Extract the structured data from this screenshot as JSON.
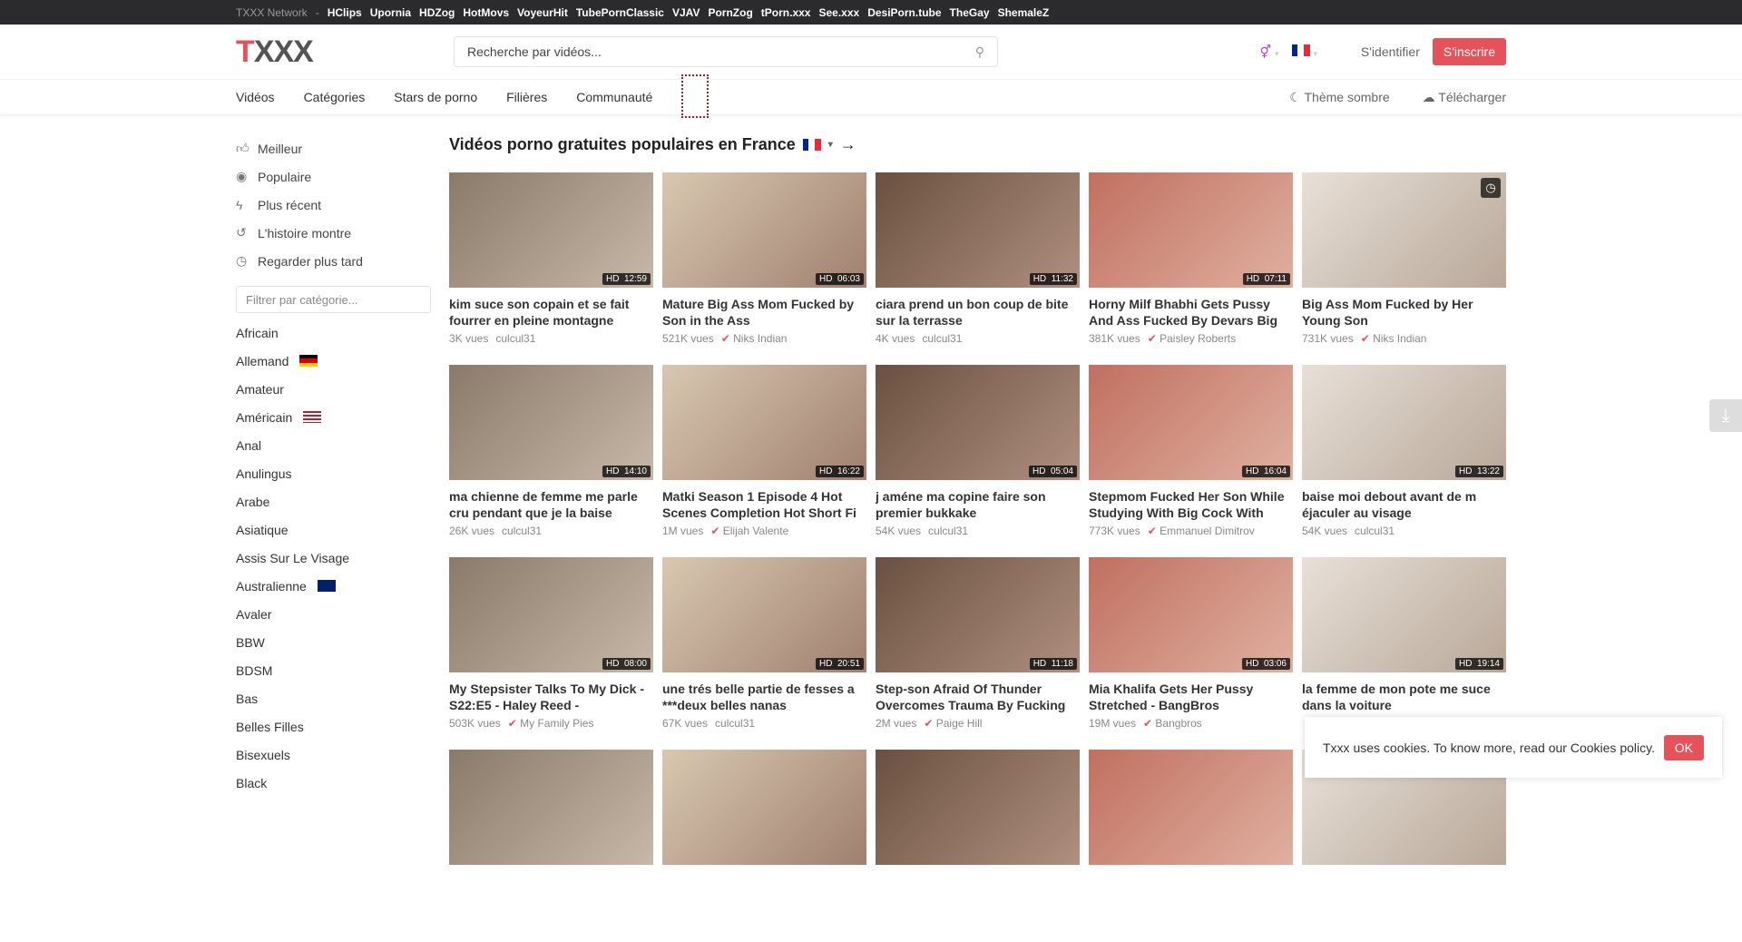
{
  "network": {
    "label": "TXXX Network",
    "sep": "-",
    "sites": [
      "HClips",
      "Upornia",
      "HDZog",
      "HotMovs",
      "VoyeurHit",
      "TubePornClassic",
      "VJAV",
      "PornZog",
      "tPorn.xxx",
      "See.xxx",
      "DesiPorn.tube",
      "TheGay",
      "ShemaleZ"
    ]
  },
  "header": {
    "logo_t": "T",
    "logo_x": "XXX",
    "search_placeholder": "Recherche par vidéos...",
    "login": "S'identifier",
    "signup": "S'inscrire"
  },
  "nav": {
    "items": [
      "Vidéos",
      "Catégories",
      "Stars de porno",
      "Filières",
      "Communauté"
    ],
    "dark_theme": "Thème sombre",
    "upload": "Télécharger"
  },
  "sidebar": {
    "items": [
      {
        "icon": "thumbs-up-icon",
        "label": "Meilleur"
      },
      {
        "icon": "eye-icon",
        "label": "Populaire"
      },
      {
        "icon": "bolt-icon",
        "label": "Plus récent"
      },
      {
        "icon": "history-icon",
        "label": "L'histoire montre"
      },
      {
        "icon": "clock-icon",
        "label": "Regarder plus tard"
      }
    ],
    "filter_placeholder": "Filtrer par catégorie...",
    "categories": [
      {
        "label": "Africain"
      },
      {
        "label": "Allemand",
        "flag": "de"
      },
      {
        "label": "Amateur"
      },
      {
        "label": "Américain",
        "flag": "us"
      },
      {
        "label": "Anal"
      },
      {
        "label": "Anulingus"
      },
      {
        "label": "Arabe"
      },
      {
        "label": "Asiatique"
      },
      {
        "label": "Assis Sur Le Visage"
      },
      {
        "label": "Australienne",
        "flag": "au"
      },
      {
        "label": "Avaler"
      },
      {
        "label": "BBW"
      },
      {
        "label": "BDSM"
      },
      {
        "label": "Bas"
      },
      {
        "label": "Belles Filles"
      },
      {
        "label": "Bisexuels"
      },
      {
        "label": "Black"
      }
    ]
  },
  "main": {
    "title": "Vidéos porno gratuites populaires en France",
    "videos": [
      {
        "title": "kim suce son copain et se fait fourrer en pleine montagne",
        "views": "3K vues",
        "author": "culcul31",
        "verified": false,
        "duration": "12:59"
      },
      {
        "title": "Mature Big Ass Mom Fucked by Son in the Ass",
        "views": "521K vues",
        "author": "Niks Indian",
        "verified": true,
        "duration": "06:03"
      },
      {
        "title": "ciara prend un bon coup de bite sur la terrasse",
        "views": "4K vues",
        "author": "culcul31",
        "verified": false,
        "duration": "11:32"
      },
      {
        "title": "Horny Milf Bhabhi Gets Pussy And Ass Fucked By Devars Big Cock",
        "views": "381K vues",
        "author": "Paisley Roberts",
        "verified": true,
        "duration": "07:11"
      },
      {
        "title": "Big Ass Mom Fucked by Her Young Son",
        "views": "731K vues",
        "author": "Niks Indian",
        "verified": true,
        "watch_later": true
      },
      {
        "title": "ma chienne de femme me parle cru pendant que je la baise",
        "views": "26K vues",
        "author": "culcul31",
        "verified": false,
        "duration": "14:10"
      },
      {
        "title": "Matki Season 1 Episode 4 Hot Scenes Completion Hot Short Fi",
        "views": "1M vues",
        "author": "Elijah Valente",
        "verified": true,
        "duration": "16:22"
      },
      {
        "title": "j améne ma copine faire son premier bukkake",
        "views": "54K vues",
        "author": "culcul31",
        "verified": false,
        "duration": "05:04"
      },
      {
        "title": "Stepmom Fucked Her Son While Studying With Big Cock With Clear",
        "views": "773K vues",
        "author": "Emmanuel Dimitrov",
        "verified": true,
        "duration": "16:04"
      },
      {
        "title": "baise moi debout avant de m éjaculer au visage",
        "views": "54K vues",
        "author": "culcul31",
        "verified": false,
        "duration": "13:22"
      },
      {
        "title": "My Stepsister Talks To My Dick - S22:E5 - Haley Reed -",
        "views": "503K vues",
        "author": "My Family Pies",
        "verified": true,
        "duration": "08:00"
      },
      {
        "title": "une trés belle partie de fesses a ***deux belles nanas",
        "views": "67K vues",
        "author": "culcul31",
        "verified": false,
        "duration": "20:51"
      },
      {
        "title": "Step-son Afraid Of Thunder Overcomes Trauma By Fucking",
        "views": "2M vues",
        "author": "Paige Hill",
        "verified": true,
        "duration": "11:18"
      },
      {
        "title": "Mia Khalifa Gets Her Pussy Stretched - BangBros",
        "views": "19M vues",
        "author": "Bangbros",
        "verified": true,
        "duration": "03:06"
      },
      {
        "title": "la femme de mon pote me suce dans la voiture",
        "duration": "19:14"
      },
      {},
      {},
      {},
      {},
      {}
    ]
  },
  "cookie": {
    "text": "Txxx uses cookies. To know more, read our Cookies policy.",
    "ok": "OK"
  },
  "colors": {
    "accent": "#e5525a",
    "topbar": "#2b2b2d"
  }
}
